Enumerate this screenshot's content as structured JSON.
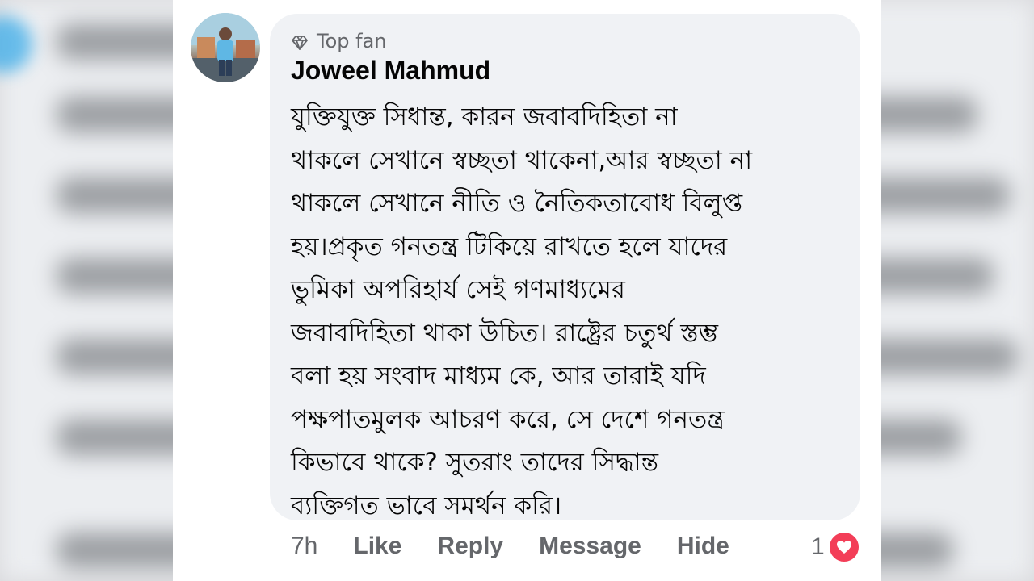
{
  "comment": {
    "badge": "Top fan",
    "badge_icon": "diamond-icon",
    "author": "Joweel Mahmud",
    "text": "যুক্তিযুক্ত  সিধান্ত, কারন জবাবদিহিতা না\nথাকলে সেখানে স্বচ্ছতা থাকেনা,আর স্বচ্ছতা না\nথাকলে সেখানে নীতি ও নৈতিকতাবোধ বিলুপ্ত\nহয়।প্রকৃত গনতন্ত্র টিকিয়ে রাখতে হলে যাদের\nভুমিকা অপরিহার্য সেই গণমাধ্যমের\nজবাবদিহিতা থাকা উচিত। রাষ্ট্রের চতুর্থ স্তম্ভ\nবলা হয় সংবাদ মাধ্যম কে, আর তারাই যদি\nপক্ষপাতমুলক  আচরণ করে, সে দেশে গনতন্ত্র\nকিভাবে থাকে?  সুতরাং তাদের সিদ্ধান্ত\nব্যক্তিগত ভাবে সমর্থন করি।"
  },
  "actions": {
    "time": "7h",
    "like": "Like",
    "reply": "Reply",
    "message": "Message",
    "hide": "Hide"
  },
  "reactions": {
    "count": "1",
    "icon": "heart-icon",
    "color": "#f33e58"
  },
  "colors": {
    "bubble": "#f0f2f5",
    "secondary_text": "#65676b",
    "primary_text": "#050505"
  }
}
